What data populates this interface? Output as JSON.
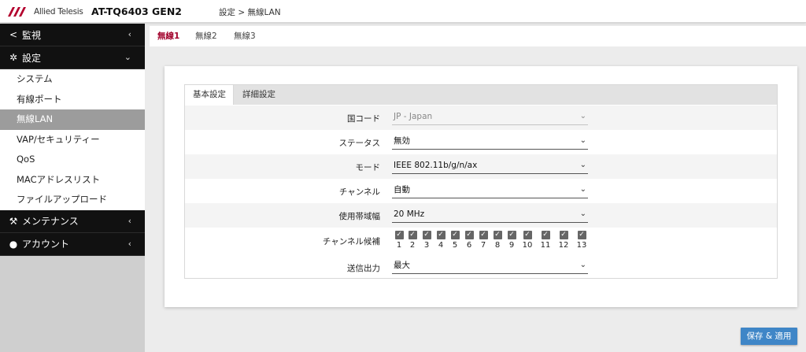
{
  "header": {
    "brand": "Allied Telesis",
    "model": "AT-TQ6403 GEN2",
    "breadcrumb": "設定 > 無線LAN"
  },
  "sidebar": {
    "monitor": "監視",
    "settings": "設定",
    "settings_items": [
      "システム",
      "有線ポート",
      "無線LAN",
      "VAP/セキュリティー",
      "QoS",
      "MACアドレスリスト",
      "ファイルアップロード"
    ],
    "maintenance": "メンテナンス",
    "account": "アカウント"
  },
  "tabs": [
    "無線1",
    "無線2",
    "無線3"
  ],
  "inner_tabs": [
    "基本設定",
    "詳細設定"
  ],
  "form": {
    "country_label": "国コード",
    "country_value": "JP - Japan",
    "status_label": "ステータス",
    "status_value": "無効",
    "mode_label": "モード",
    "mode_value": "IEEE 802.11b/g/n/ax",
    "channel_label": "チャンネル",
    "channel_value": "自動",
    "bandwidth_label": "使用帯域幅",
    "bandwidth_value": "20 MHz",
    "candidates_label": "チャンネル候補",
    "candidates": [
      "1",
      "2",
      "3",
      "4",
      "5",
      "6",
      "7",
      "8",
      "9",
      "10",
      "11",
      "12",
      "13"
    ],
    "power_label": "送信出力",
    "power_value": "最大"
  },
  "apply_button": "保存 & 適用",
  "colors": {
    "accent": "#a1002a",
    "button": "#3f86c7",
    "nav_bg": "#111111",
    "active_item": "#9c9c9c"
  }
}
